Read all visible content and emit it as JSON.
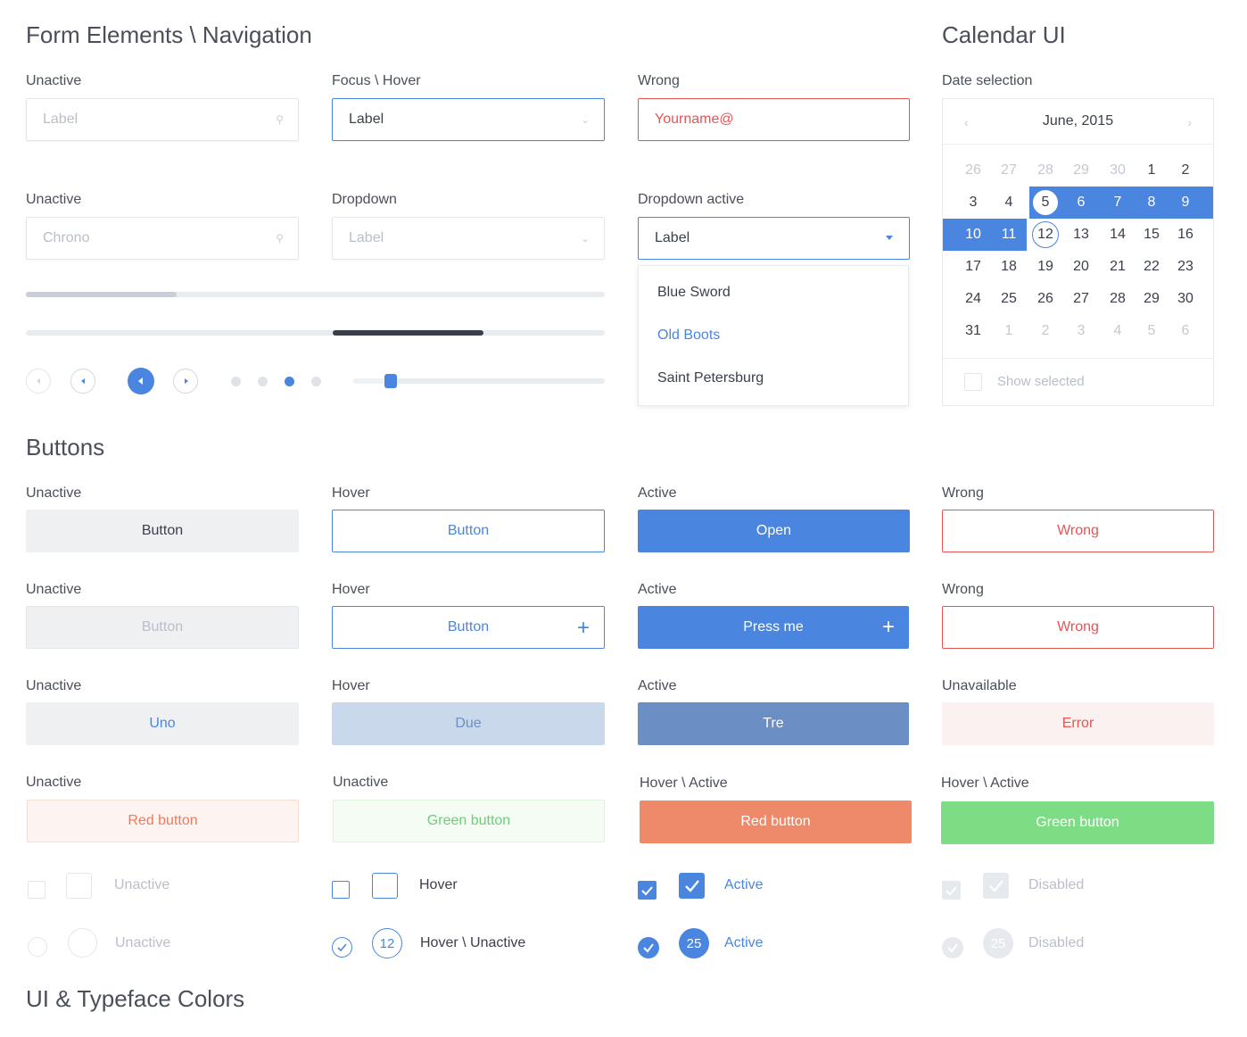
{
  "sections": {
    "form_title": "Form Elements \\ Navigation",
    "calendar_title": "Calendar UI",
    "buttons_title": "Buttons",
    "colors_title": "UI & Typeface Colors"
  },
  "form": {
    "row1": [
      {
        "label": "Unactive",
        "value": "Label"
      },
      {
        "label": "Focus \\ Hover",
        "value": "Label"
      },
      {
        "label": "Wrong",
        "value": "Yourname@"
      }
    ],
    "row2": [
      {
        "label": "Unactive",
        "value": "Chrono"
      },
      {
        "label": "Dropdown",
        "value": "Label"
      },
      {
        "label": "Dropdown active",
        "value": "Label"
      }
    ],
    "dropdown_options": [
      "Blue Sword",
      "Old Boots",
      "Saint Petersburg"
    ],
    "progress_1": 0.26,
    "progress_2_start": 0.53,
    "progress_2_end": 0.79,
    "slider_value": 0.15
  },
  "calendar": {
    "label": "Date selection",
    "month": "June, 2015",
    "prev_icon": "chevron-left-icon",
    "next_icon": "chevron-right-icon",
    "weeks": [
      [
        "26",
        "27",
        "28",
        "29",
        "30",
        "1",
        "2"
      ],
      [
        "3",
        "4",
        "5",
        "6",
        "7",
        "8",
        "9"
      ],
      [
        "10",
        "11",
        "12",
        "13",
        "14",
        "15",
        "16"
      ],
      [
        "17",
        "18",
        "19",
        "20",
        "21",
        "22",
        "23"
      ],
      [
        "24",
        "25",
        "26",
        "27",
        "28",
        "29",
        "30"
      ],
      [
        "31",
        "1",
        "2",
        "3",
        "4",
        "5",
        "6"
      ]
    ],
    "show_selected": "Show selected"
  },
  "buttons": {
    "rows": [
      [
        {
          "label": "Unactive",
          "text": "Button"
        },
        {
          "label": "Hover",
          "text": "Button"
        },
        {
          "label": "Active",
          "text": "Open"
        },
        {
          "label": "Wrong",
          "text": "Wrong"
        }
      ],
      [
        {
          "label": "Unactive",
          "text": "Button"
        },
        {
          "label": "Hover",
          "text": "Button"
        },
        {
          "label": "Active",
          "text": "Press me"
        },
        {
          "label": "Wrong",
          "text": "Wrong"
        }
      ],
      [
        {
          "label": "Unactive",
          "text": "Uno"
        },
        {
          "label": "Hover",
          "text": "Due"
        },
        {
          "label": "Active",
          "text": "Tre"
        },
        {
          "label": "Unavailable",
          "text": "Error"
        }
      ],
      [
        {
          "label": "Unactive",
          "text": "Red button"
        },
        {
          "label": "Unactive",
          "text": "Green button"
        },
        {
          "label": "Hover \\ Active",
          "text": "Red button"
        },
        {
          "label": "Hover \\ Active",
          "text": "Green button"
        }
      ]
    ]
  },
  "toggles": {
    "checkbox_row": [
      "Unactive",
      "Hover",
      "Active",
      "Disabled"
    ],
    "radio_row": [
      "Unactive",
      "Hover \\ Unactive",
      "Active",
      "Disabled"
    ],
    "radio_badges": [
      "12",
      "25",
      "25"
    ]
  },
  "colors": {
    "accent": "#4a86e0",
    "error": "#e85454",
    "red_button": "#ee8a6a",
    "green_button": "#7cdd84"
  }
}
